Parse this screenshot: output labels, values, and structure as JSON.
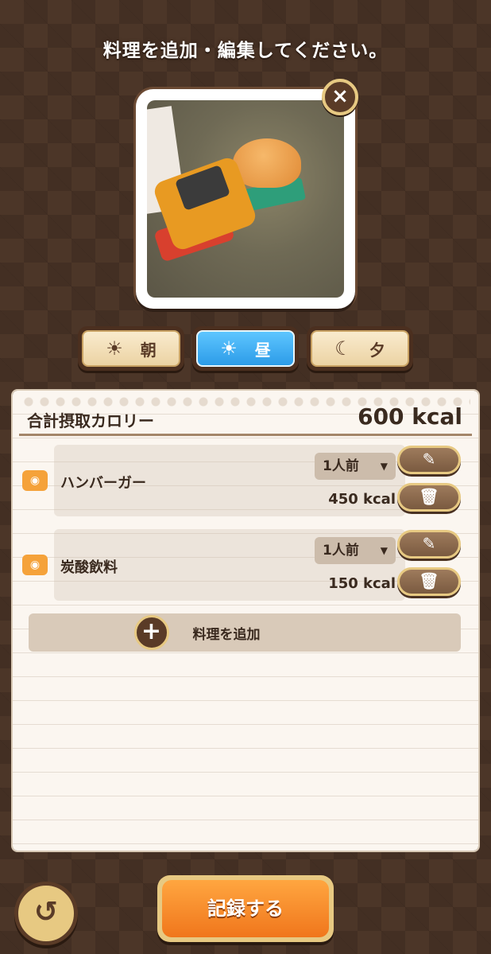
{
  "header": {
    "title": "料理を追加・編集してください。"
  },
  "photo": {
    "close_label": "×"
  },
  "meal_tabs": [
    {
      "icon": "☀",
      "label": "朝",
      "active": false
    },
    {
      "icon": "☀",
      "label": "昼",
      "active": true
    },
    {
      "icon": "☾",
      "label": "夕",
      "active": false
    }
  ],
  "summary": {
    "label": "合計摂取カロリー",
    "value": "600 kcal"
  },
  "items": [
    {
      "name": "ハンバーガー",
      "portion": "1人前",
      "kcal": "450 kcal"
    },
    {
      "name": "炭酸飲料",
      "portion": "1人前",
      "kcal": "150 kcal"
    }
  ],
  "add_item": {
    "label": "料理を追加",
    "icon": "+"
  },
  "footer": {
    "record_label": "記録する",
    "back_icon": "↺"
  },
  "icons": {
    "edit": "✎",
    "delete": "🗑",
    "camera": "◉",
    "caret": "▼"
  },
  "colors": {
    "accent_orange": "#f0761c",
    "active_blue": "#2c9ce8",
    "brown": "#5a3b27",
    "gold": "#e7c982"
  }
}
